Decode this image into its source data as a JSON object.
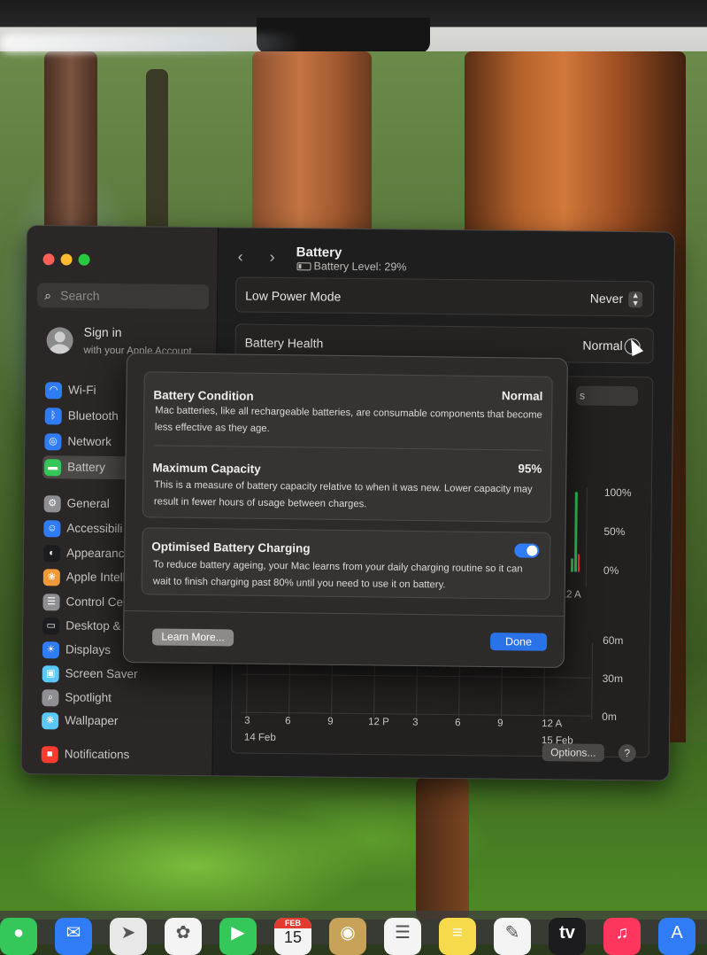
{
  "window": {
    "title": "Battery",
    "battery_level": "Battery Level: 29%",
    "search_placeholder": "Search",
    "signin_title": "Sign in",
    "signin_sub": "with your Apple Account"
  },
  "sidebar": {
    "items": [
      {
        "label": "Wi-Fi",
        "icon": "wifi-icon",
        "color": "#2f7cf6"
      },
      {
        "label": "Bluetooth",
        "icon": "bluetooth-icon",
        "color": "#2f7cf6"
      },
      {
        "label": "Network",
        "icon": "globe-icon",
        "color": "#2f7cf6"
      },
      {
        "label": "Battery",
        "icon": "battery-icon",
        "color": "#35c759",
        "selected": true
      },
      {
        "label": "General",
        "icon": "gear-icon",
        "color": "#8e8e93"
      },
      {
        "label": "Accessibili",
        "icon": "accessibility-icon",
        "color": "#2f7cf6"
      },
      {
        "label": "Appearanc",
        "icon": "appearance-icon",
        "color": "#1c1c1e"
      },
      {
        "label": "Apple Intell",
        "icon": "apple-intelligence-icon",
        "color": "#f09a37"
      },
      {
        "label": "Control Ce",
        "icon": "control-centre-icon",
        "color": "#8e8e93"
      },
      {
        "label": "Desktop &",
        "icon": "desktop-dock-icon",
        "color": "#1c1c1e"
      },
      {
        "label": "Displays",
        "icon": "displays-icon",
        "color": "#2f7cf6"
      },
      {
        "label": "Screen Saver",
        "icon": "screen-saver-icon",
        "color": "#5ac8fa"
      },
      {
        "label": "Spotlight",
        "icon": "spotlight-icon",
        "color": "#8e8e93"
      },
      {
        "label": "Wallpaper",
        "icon": "wallpaper-icon",
        "color": "#5ac8fa"
      },
      {
        "label": "Notifications",
        "icon": "notifications-icon",
        "color": "#ff3b30"
      }
    ]
  },
  "settings": {
    "low_power_label": "Low Power Mode",
    "low_power_value": "Never",
    "health_label": "Battery Health",
    "health_value": "Normal",
    "options_label": "Options...",
    "help_label": "?"
  },
  "chart": {
    "segment_label": "s",
    "level_ticks": [
      "100%",
      "50%",
      "0%"
    ],
    "level_x_tick": "12 A",
    "usage_ticks": [
      "60m",
      "30m",
      "0m"
    ],
    "x_ticks": [
      "3",
      "6",
      "9",
      "12 P",
      "3",
      "6",
      "9",
      "12 A"
    ],
    "date_start": "14 Feb",
    "date_end": "15 Feb"
  },
  "sheet": {
    "condition_title": "Battery Condition",
    "condition_value": "Normal",
    "condition_desc": "Mac batteries, like all rechargeable batteries, are consumable components that become less effective as they age.",
    "capacity_title": "Maximum Capacity",
    "capacity_value": "95%",
    "capacity_desc": "This is a measure of battery capacity relative to when it was new. Lower capacity may result in fewer hours of usage between charges.",
    "charging_title": "Optimised Battery Charging",
    "charging_enabled": true,
    "charging_desc": "To reduce battery ageing, your Mac learns from your daily charging routine so it can wait to finish charging past 80% until you need to use it on battery.",
    "learn_more": "Learn More...",
    "done": "Done"
  },
  "dock": {
    "calendar_month": "FEB",
    "calendar_day": "15",
    "apps": [
      "messages-icon",
      "mail-icon",
      "maps-icon",
      "photos-icon",
      "facetime-icon",
      "calendar-icon",
      "contacts-icon",
      "reminders-icon",
      "notes-icon",
      "freeform-icon",
      "tv-icon",
      "music-icon",
      "app-store-icon"
    ],
    "tv_label": "tv"
  }
}
